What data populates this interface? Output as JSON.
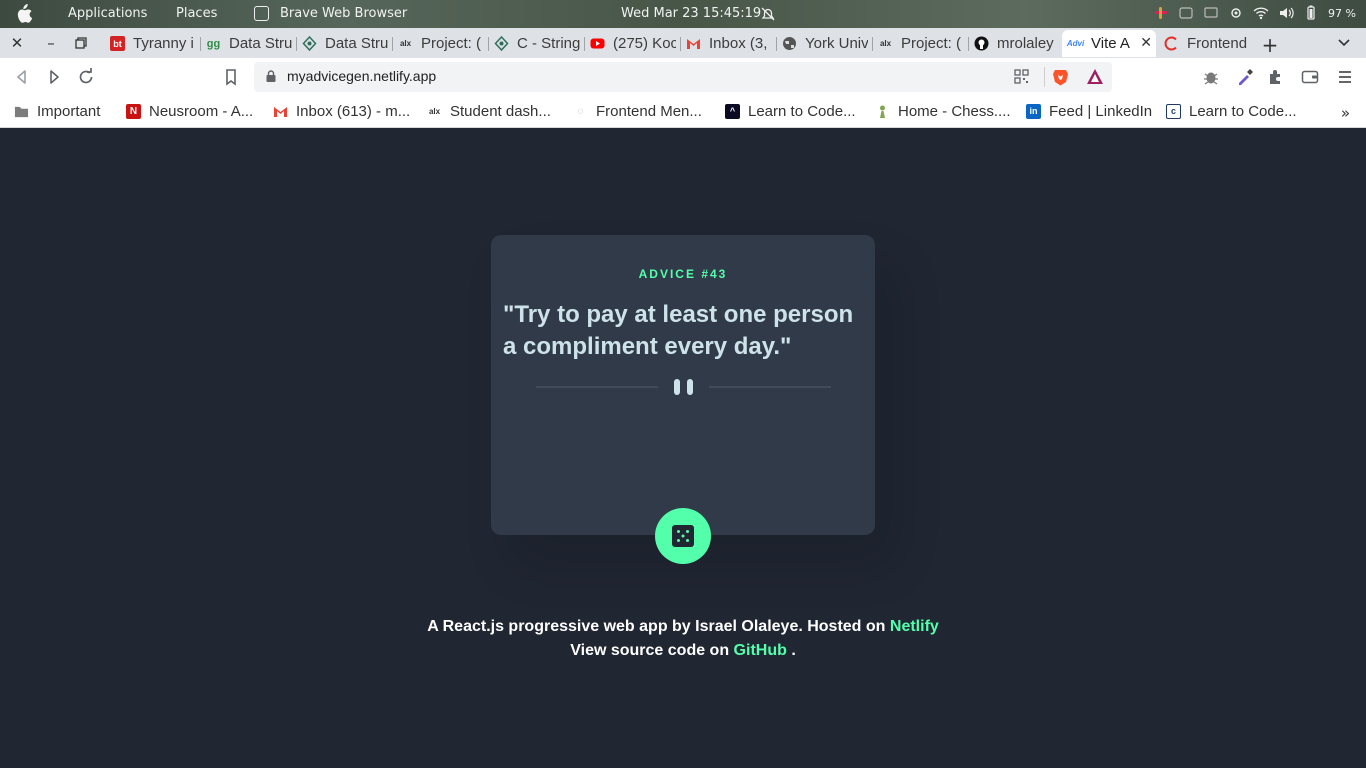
{
  "os_bar": {
    "menu_applications": "Applications",
    "menu_places": "Places",
    "active_app": "Brave Web Browser",
    "clock": "Wed Mar 23  15:45:19",
    "battery": "97 %"
  },
  "tabs": [
    {
      "label": "Tyranny i",
      "favicon_color": "#d42323"
    },
    {
      "label": "Data Stru",
      "favicon_color": "#2f8d46"
    },
    {
      "label": "Data Stru",
      "favicon_color": "#2f6f5a"
    },
    {
      "label": "Project: (",
      "favicon_color": "#333333"
    },
    {
      "label": "C - String",
      "favicon_color": "#2f6f5a"
    },
    {
      "label": "(275) Koc",
      "favicon_color": "#ff0000"
    },
    {
      "label": "Inbox (3,",
      "favicon_color": "#ea4335"
    },
    {
      "label": "York Univ",
      "favicon_color": "#555555"
    },
    {
      "label": "Project: (",
      "favicon_color": "#333333"
    },
    {
      "label": "mrolaley",
      "favicon_color": "#111111"
    },
    {
      "label": "Vite A",
      "favicon_color": "#3b82f6",
      "active": true
    },
    {
      "label": "Frontend",
      "favicon_color": "#e0322b"
    }
  ],
  "address": {
    "url": "myadvicegen.netlify.app"
  },
  "bookmarks": [
    {
      "label": "Important"
    },
    {
      "label": "Neusroom - A..."
    },
    {
      "label": "Inbox (613) - m..."
    },
    {
      "label": "Student dash..."
    },
    {
      "label": "Frontend Men..."
    },
    {
      "label": "Learn to Code..."
    },
    {
      "label": "Home - Chess...."
    },
    {
      "label": "Feed | LinkedIn"
    },
    {
      "label": "Learn to Code..."
    }
  ],
  "bookmarks_more": "»",
  "app": {
    "advice_label": "ADVICE #43",
    "quote": "\"Try to pay at least one person a compliment every day.\"",
    "footer_line1_prefix": "A React.js progressive web app by Israel Olaleye. Hosted on ",
    "footer_link1": "Netlify",
    "footer_line2_prefix": "View source code on ",
    "footer_link2": "GitHub",
    "footer_line2_suffix": " .",
    "accent_color": "#53ffaa",
    "card_color": "#313a48",
    "bg_color": "#202632"
  }
}
